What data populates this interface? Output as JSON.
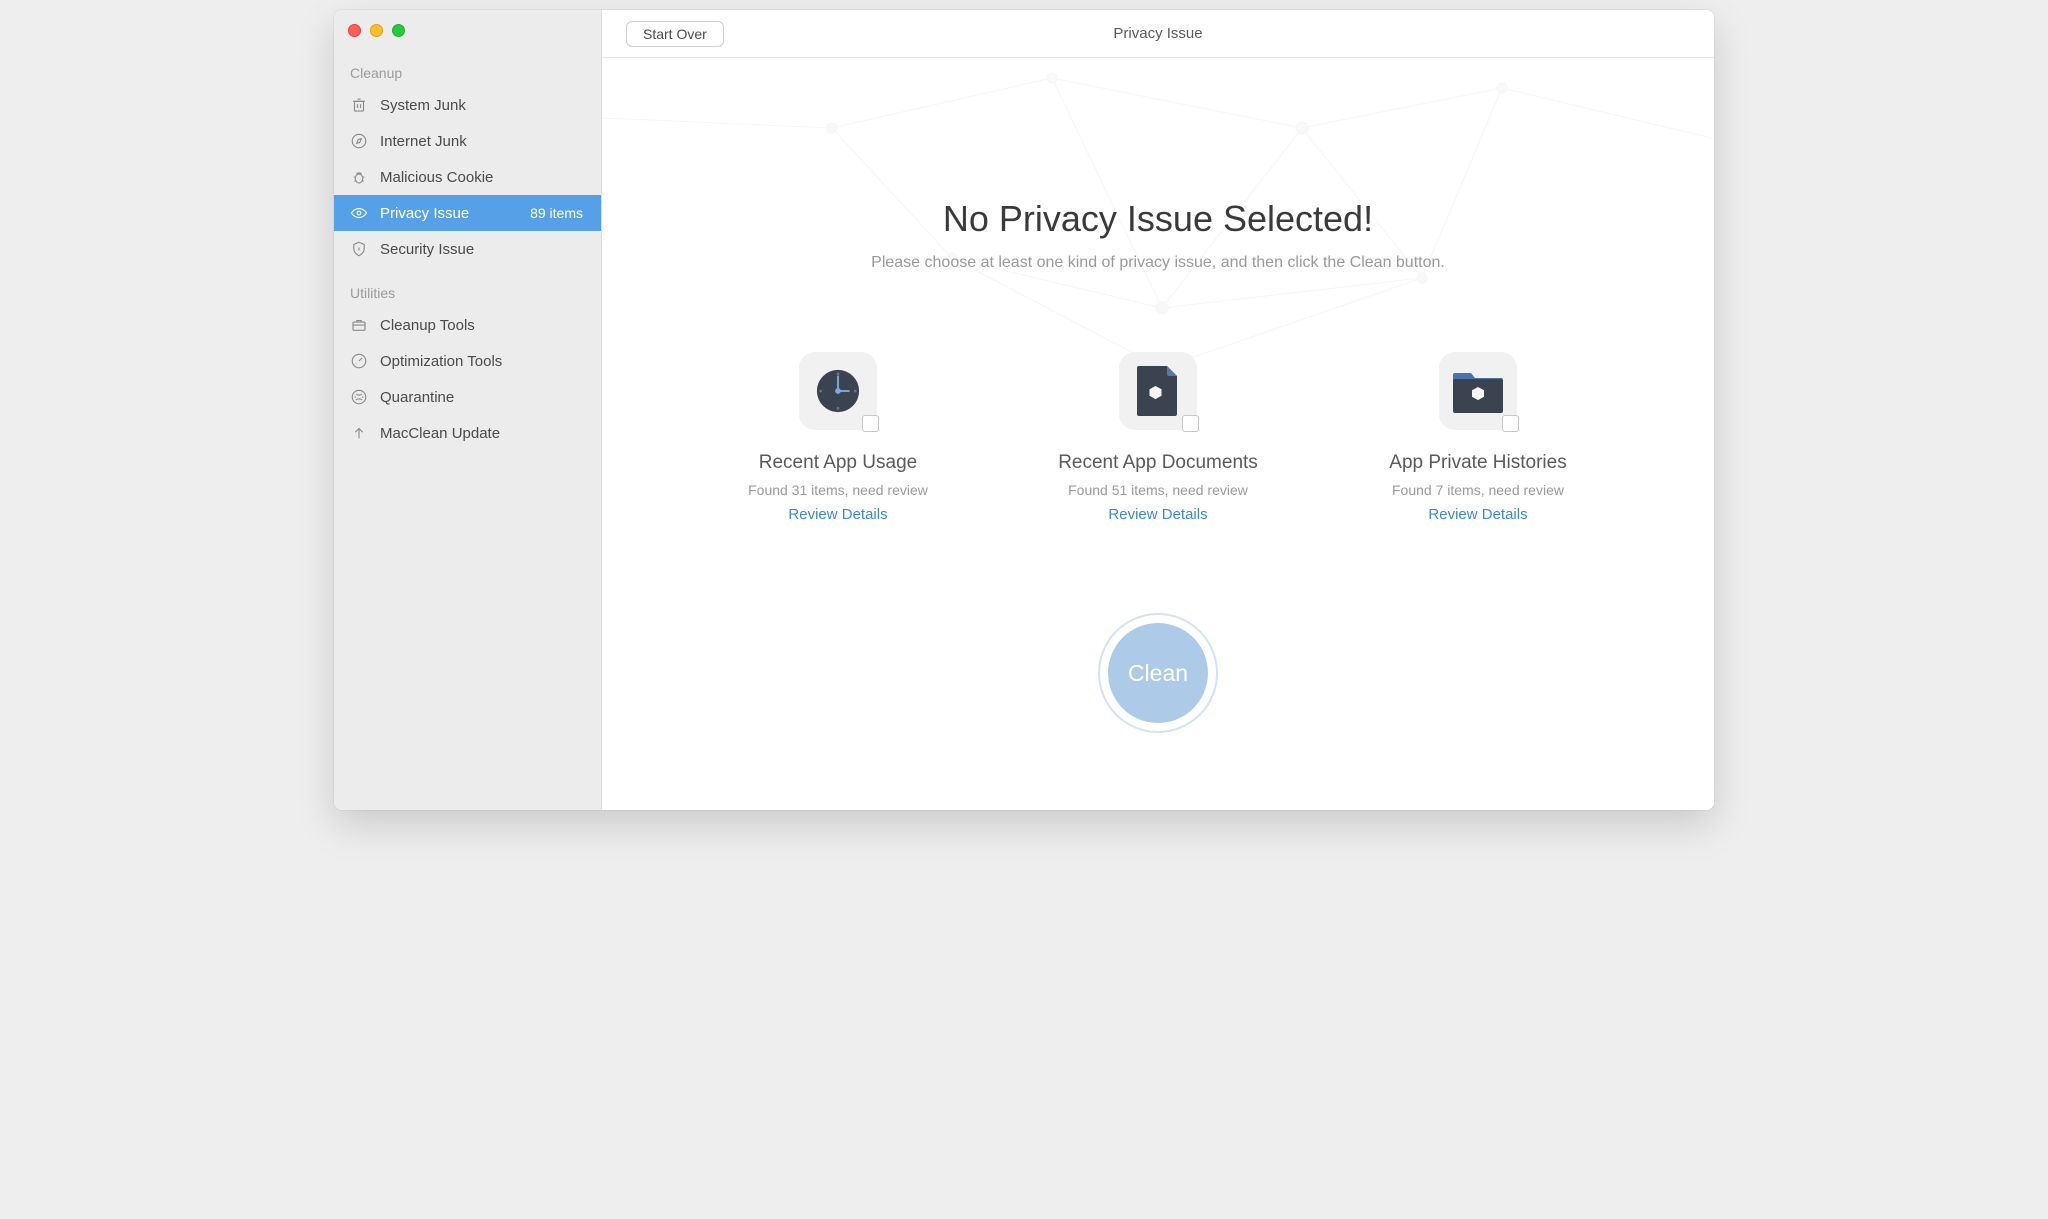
{
  "header": {
    "start_over": "Start Over",
    "title": "Privacy Issue"
  },
  "sidebar": {
    "section1": "Cleanup",
    "section2": "Utilities",
    "items_cleanup": [
      {
        "label": "System Junk"
      },
      {
        "label": "Internet Junk"
      },
      {
        "label": "Malicious Cookie"
      },
      {
        "label": "Privacy Issue",
        "badge": "89 items"
      },
      {
        "label": "Security Issue"
      }
    ],
    "items_utilities": [
      {
        "label": "Cleanup Tools"
      },
      {
        "label": "Optimization Tools"
      },
      {
        "label": "Quarantine"
      },
      {
        "label": "MacClean Update"
      }
    ]
  },
  "message": {
    "heading": "No Privacy Issue Selected!",
    "sub": "Please choose at least one kind of privacy issue, and then click the Clean button."
  },
  "cards": [
    {
      "title": "Recent App Usage",
      "sub": "Found 31 items, need review",
      "link": "Review Details"
    },
    {
      "title": "Recent App Documents",
      "sub": "Found 51 items, need review",
      "link": "Review Details"
    },
    {
      "title": "App Private Histories",
      "sub": "Found 7 items, need review",
      "link": "Review Details"
    }
  ],
  "clean_label": "Clean"
}
